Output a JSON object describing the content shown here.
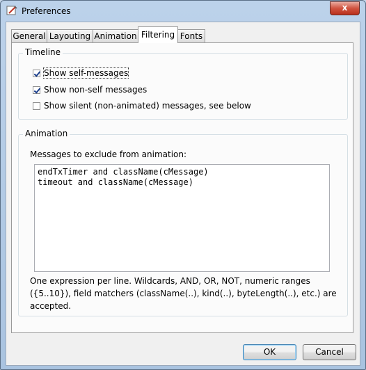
{
  "window": {
    "title": "Preferences",
    "close_glyph": "x"
  },
  "tabs": [
    {
      "label": "General"
    },
    {
      "label": "Layouting"
    },
    {
      "label": "Animation"
    },
    {
      "label": "Filtering",
      "active": true
    },
    {
      "label": "Fonts"
    }
  ],
  "timeline": {
    "heading": "Timeline",
    "options": [
      {
        "label": "Show self-messages",
        "checked": true
      },
      {
        "label": "Show non-self messages",
        "checked": true
      },
      {
        "label": "Show silent (non-animated) messages, see below",
        "checked": false
      }
    ]
  },
  "animation": {
    "heading": "Animation",
    "exclude_label": "Messages to exclude from animation:",
    "exclude_text": "endTxTimer and className(cMessage)\ntimeout and className(cMessage)",
    "hint": "One expression per line. Wildcards, AND, OR, NOT, numeric ranges ({5..10}), field matchers (className(..), kind(..), byteLength(..), etc.) are accepted."
  },
  "buttons": {
    "ok": "OK",
    "cancel": "Cancel"
  },
  "colors": {
    "accent": "#3c7fb1",
    "close": "#c7402c",
    "checkmark": "#1c3f8c"
  },
  "icons": {
    "app": "preferences-app-icon",
    "checkbox": "checkmark-icon"
  }
}
